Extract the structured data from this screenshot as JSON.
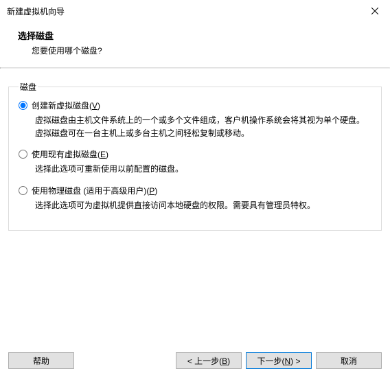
{
  "window": {
    "title": "新建虚拟机向导"
  },
  "header": {
    "title": "选择磁盘",
    "subtitle": "您要使用哪个磁盘?"
  },
  "groupbox": {
    "legend": "磁盘"
  },
  "options": {
    "create": {
      "label_pre": "创建新虚拟磁盘(",
      "label_key": "V",
      "label_post": ")",
      "desc": "虚拟磁盘由主机文件系统上的一个或多个文件组成，客户机操作系统会将其视为单个硬盘。虚拟磁盘可在一台主机上或多台主机之间轻松复制或移动。",
      "checked": true
    },
    "existing": {
      "label_pre": "使用现有虚拟磁盘(",
      "label_key": "E",
      "label_post": ")",
      "desc": "选择此选项可重新使用以前配置的磁盘。",
      "checked": false
    },
    "physical": {
      "label_pre": "使用物理磁盘 (适用于高级用户)(",
      "label_key": "P",
      "label_post": ")",
      "desc": "选择此选项可为虚拟机提供直接访问本地硬盘的权限。需要具有管理员特权。",
      "checked": false
    }
  },
  "footer": {
    "help": "帮助",
    "back_pre": "< 上一步(",
    "back_key": "B",
    "back_post": ")",
    "next_pre": "下一步(",
    "next_key": "N",
    "next_post": ") >",
    "cancel": "取消"
  }
}
